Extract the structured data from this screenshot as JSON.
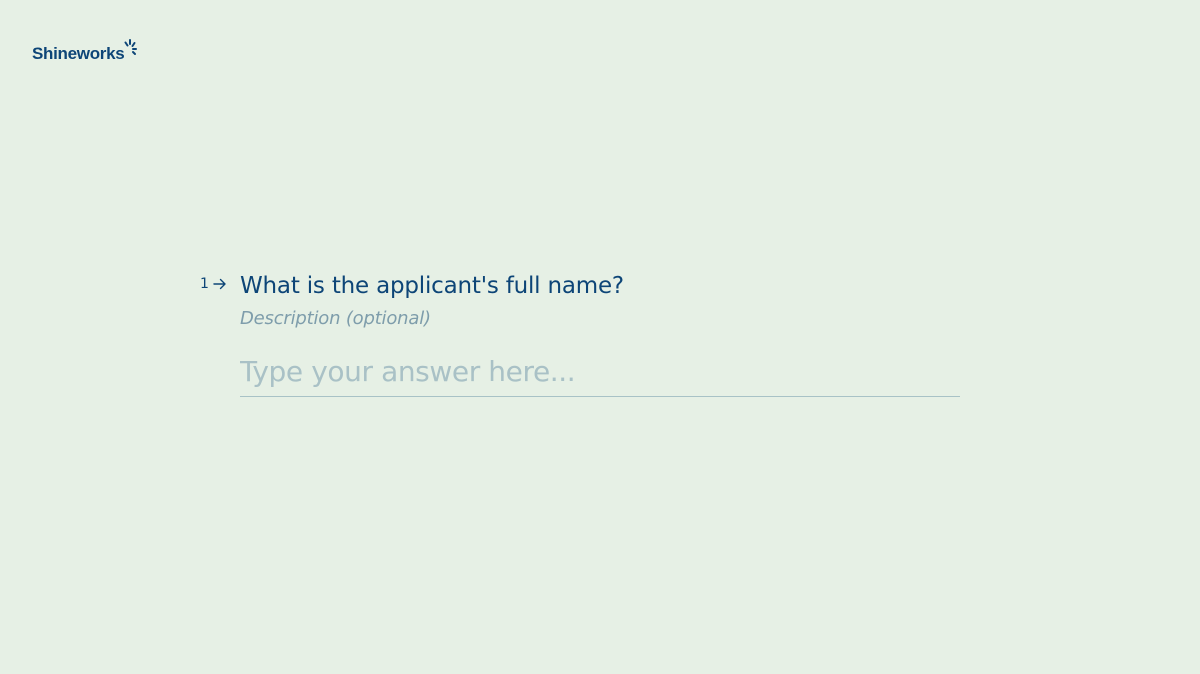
{
  "brand": {
    "name": "Shineworks",
    "icon": "sparkle-icon",
    "color": "#0d4577"
  },
  "question": {
    "number": "1",
    "arrow_icon": "arrow-right-icon",
    "title": "What is the applicant's full name?",
    "description": "Description (optional)",
    "answer_placeholder": "Type your answer here...",
    "answer_value": ""
  },
  "colors": {
    "background": "#e6f0e5",
    "text_primary": "#0d4577",
    "text_muted": "#7e9dab",
    "input_underline": "#a8c2c6"
  }
}
